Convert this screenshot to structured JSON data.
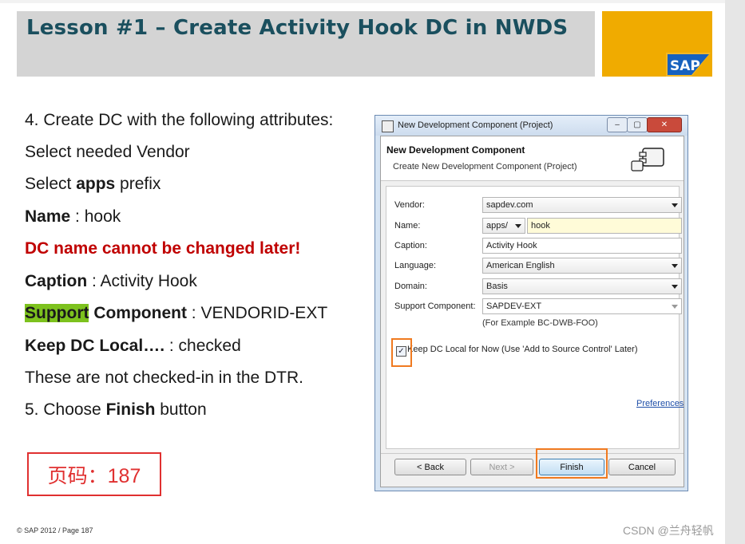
{
  "slide": {
    "title": "Lesson #1 – Create Activity Hook DC in NWDS",
    "logo_text": "SAP",
    "lines": {
      "l1": "4. Create DC with  the following attributes:",
      "l2": "Select needed Vendor",
      "l3_pre": "Select ",
      "l3_bold": "apps",
      "l3_post": " prefix",
      "l4_bold": "Name",
      "l4_post": " : hook",
      "l5": "DC name cannot be changed later!",
      "l6_bold": "Caption",
      "l6_post": " : Activity Hook",
      "l7_hl": "Support",
      "l7_bold": " Component",
      "l7_post": " : VENDORID-EXT",
      "l8_bold": "Keep DC Local….",
      "l8_post": " : checked",
      "l9": "These are not checked-in in the DTR.",
      "l10_pre": "5. Choose ",
      "l10_bold": "Finish",
      "l10_post": " button"
    },
    "page_label": "页码：187",
    "footer": "© SAP 2012  / Page 187",
    "watermark": "CSDN @兰舟轻帆"
  },
  "dialog": {
    "window_title": "New Development Component (Project)",
    "header_title": "New Development Component",
    "header_subtitle": "Create New Development Component (Project)",
    "labels": {
      "vendor": "Vendor:",
      "name": "Name:",
      "caption": "Caption:",
      "language": "Language:",
      "domain": "Domain:",
      "support": "Support Component:"
    },
    "values": {
      "vendor": "sapdev.com",
      "prefix": "apps/",
      "name": "hook",
      "caption": "Activity Hook",
      "language": "American English",
      "domain": "Basis",
      "support": "SAPDEV-EXT"
    },
    "hint": "(For Example BC-DWB-FOO)",
    "keep_local_label": "Keep DC Local for Now (Use 'Add to Source Control' Later)",
    "keep_local_checked": true,
    "preferences_link": "Preferences",
    "buttons": {
      "back": "< Back",
      "next": "Next >",
      "finish": "Finish",
      "cancel": "Cancel"
    }
  },
  "colors": {
    "title_text": "#1a4f5e",
    "sap_gold": "#f0ab00",
    "warning_red": "#c00000",
    "highlight_green": "#7dc21e",
    "callout_orange": "#f07a20"
  }
}
